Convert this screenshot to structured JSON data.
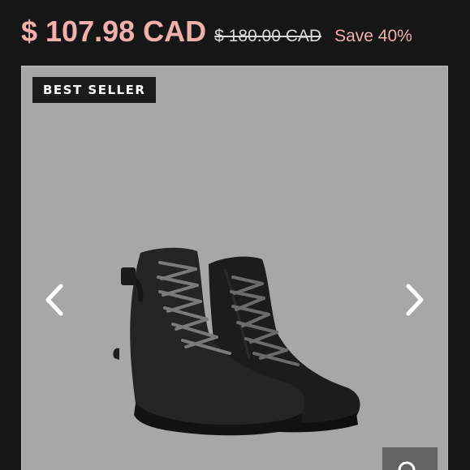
{
  "pricing": {
    "sale_price": "$ 107.98 CAD",
    "original_price": "$ 180.00 CAD",
    "savings": "Save 40%"
  },
  "gallery": {
    "badge": "BEST SELLER",
    "background_color": "#a7a7a7",
    "prev_icon": "chevron-left-icon",
    "next_icon": "chevron-right-icon",
    "zoom_icon": "zoom-icon"
  },
  "colors": {
    "price_accent": "#f2b0ac",
    "page_background": "#161616"
  }
}
